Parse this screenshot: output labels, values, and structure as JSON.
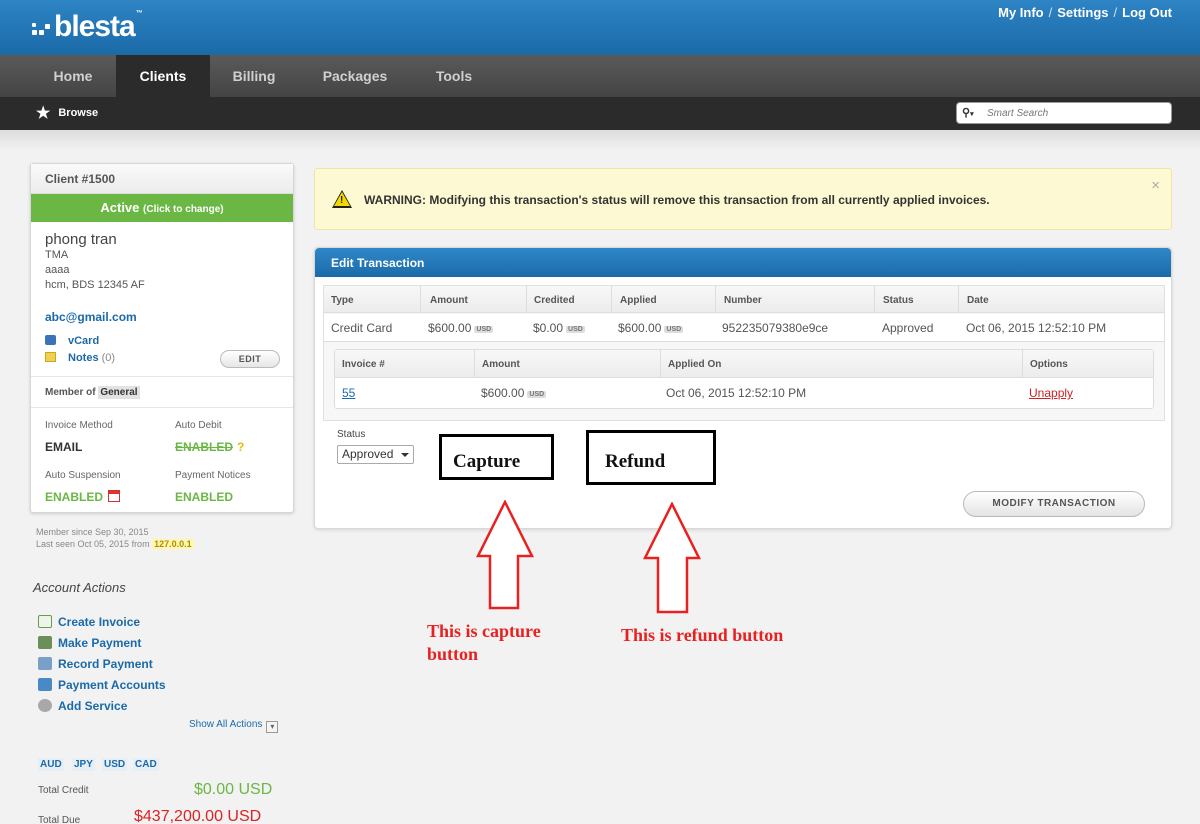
{
  "header": {
    "logo": "blesta",
    "logo_tm": "™",
    "links": [
      "My Info",
      "Settings",
      "Log Out"
    ],
    "link_sep": "/"
  },
  "nav": {
    "items": [
      "Home",
      "Clients",
      "Billing",
      "Packages",
      "Tools"
    ],
    "active": "Clients"
  },
  "subnav": {
    "browse": "Browse",
    "search_placeholder": "Smart Search"
  },
  "client": {
    "id_label": "Client #1500",
    "status": "Active",
    "status_hint": "(Click to change)",
    "name": "phong tran",
    "company": "TMA",
    "address1": "aaaa",
    "address2": "hcm, BDS 12345 AF",
    "email": "abc@gmail.com",
    "vcard": "vCard",
    "notes": "Notes",
    "notes_count": "(0)",
    "edit": "EDIT",
    "member_of": "Member of",
    "group": "General",
    "invoice_method_label": "Invoice Method",
    "invoice_method": "EMAIL",
    "auto_debit_label": "Auto Debit",
    "auto_debit": "ENABLED",
    "auto_debit_help": "?",
    "auto_suspension_label": "Auto Suspension",
    "auto_suspension": "ENABLED",
    "payment_notices_label": "Payment Notices",
    "payment_notices": "ENABLED",
    "member_since": "Member since Sep 30, 2015",
    "last_seen": "Last seen Oct 05, 2015 from",
    "ip": "127.0.0.1"
  },
  "account_actions": {
    "title": "Account Actions",
    "items": [
      "Create Invoice",
      "Make Payment",
      "Record Payment",
      "Payment Accounts",
      "Add Service"
    ],
    "show_all": "Show All Actions",
    "currencies": [
      "AUD",
      "JPY",
      "USD",
      "CAD"
    ],
    "total_credit_label": "Total Credit",
    "total_credit": "$0.00 USD",
    "total_due_label": "Total Due",
    "total_due": "$437,200.00 USD"
  },
  "warning": {
    "text": "WARNING: Modifying this transaction's status will remove this transaction from all currently applied invoices.",
    "close": "×"
  },
  "transaction": {
    "title": "Edit Transaction",
    "columns": [
      "Type",
      "Amount",
      "Credited",
      "Applied",
      "Number",
      "Status",
      "Date"
    ],
    "row": {
      "type": "Credit Card",
      "amount": "$600.00",
      "credited": "$0.00",
      "applied": "$600.00",
      "number": "952235079380e9ce",
      "status": "Approved",
      "date": "Oct 06, 2015 12:52:10 PM"
    },
    "currency_tag": "USD",
    "invoice_columns": [
      "Invoice #",
      "Amount",
      "Applied On",
      "Options"
    ],
    "invoice_row": {
      "invoice": "55",
      "amount": "$600.00",
      "applied_on": "Oct 06, 2015 12:52:10 PM",
      "option": "Unapply"
    },
    "status_label": "Status",
    "status_value": "Approved",
    "submit": "MODIFY TRANSACTION"
  },
  "annotations": {
    "capture_box": "Capture",
    "refund_box": "Refund",
    "capture_note": "This is capture button",
    "refund_note": "This is refund button",
    "arrow_color": "#e82020"
  }
}
